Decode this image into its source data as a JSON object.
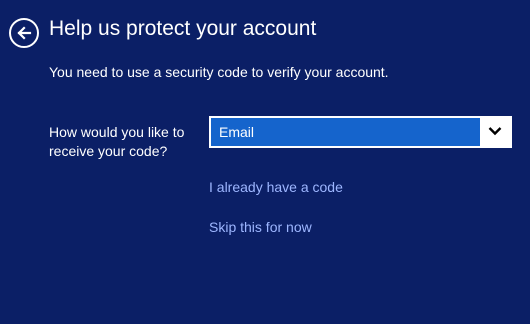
{
  "header": {
    "back_icon": "back-arrow-icon",
    "title": "Help us protect your account"
  },
  "main": {
    "subtitle": "You need to use a security code to verify your account.",
    "question": "How would you like to receive your code?",
    "method_select": {
      "selected": "Email",
      "arrow_icon": "chevron-down-icon"
    },
    "links": {
      "have_code": "I already have a code",
      "skip": "Skip this for now"
    }
  },
  "colors": {
    "background": "#0b1f66",
    "select_highlight": "#1564cc",
    "link": "#9db6ff",
    "text": "#ffffff"
  }
}
